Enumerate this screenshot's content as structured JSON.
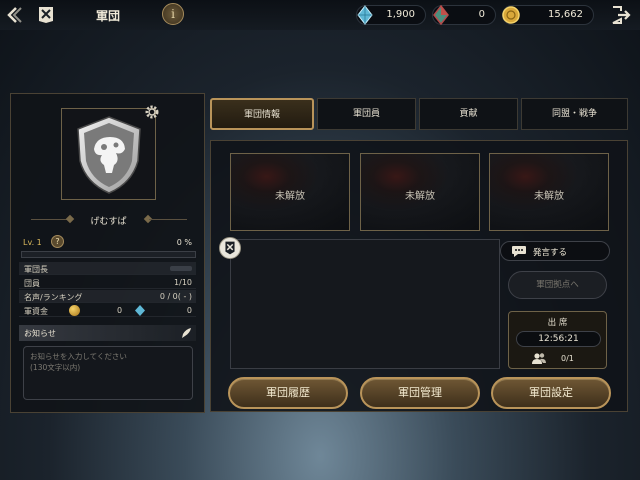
{
  "header": {
    "title": "軍団",
    "info_label": "i",
    "currencies": [
      {
        "icon": "blue-crystal-icon",
        "amount": "1,900"
      },
      {
        "icon": "red-crystal-icon",
        "amount": "0"
      },
      {
        "icon": "gold-coin-icon",
        "amount": "15,662"
      }
    ]
  },
  "guild": {
    "name": "げむすぱ",
    "level_label": "Lv. 1",
    "level_help": "?",
    "exp_percent": "0 %",
    "exp_fraction": 0,
    "stats": {
      "leader_label": "軍団長",
      "members_label": "団員",
      "members_value": "1/10",
      "fame_label": "名声/ランキング",
      "fame_value": "0 / 0( - )",
      "funds_label": "軍資金",
      "funds_gold": "0",
      "funds_crystal": "0"
    },
    "notice": {
      "title": "お知らせ",
      "placeholder": "お知らせを入力してください\n(130文字以内)"
    }
  },
  "tabs": [
    {
      "label": "軍団情報",
      "active": true
    },
    {
      "label": "軍団員",
      "active": false
    },
    {
      "label": "貢献",
      "active": false
    },
    {
      "label": "同盟・戦争",
      "active": false
    }
  ],
  "slots": [
    "未解放",
    "未解放",
    "未解放"
  ],
  "chat": {
    "post_label": "発言する",
    "base_label": "軍団拠点へ"
  },
  "attendance": {
    "title": "出 席",
    "time": "12:56:21",
    "count": "0/1"
  },
  "buttons": {
    "history": "軍団履歴",
    "manage": "軍団管理",
    "settings": "軍団設定"
  },
  "colors": {
    "accent_gold": "#b9945a",
    "panel_bg": "#101318",
    "active_tab": "#3a2f1c"
  }
}
